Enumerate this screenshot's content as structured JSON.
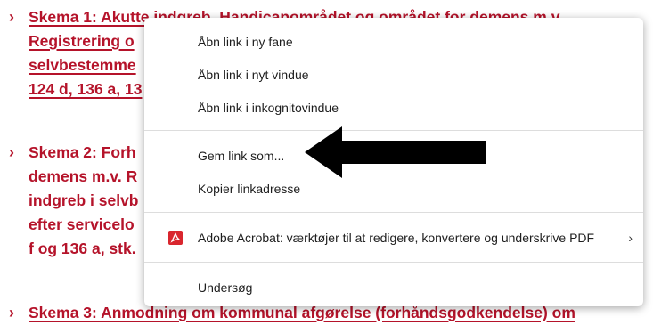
{
  "background_items": [
    {
      "lines": [
        "Skema 1: Akutte indgreb. Handicapområdet og området for demens m.v.",
        "Registrering o",
        "selvbestemme",
        "124 d, 136 a, 13"
      ],
      "link": true
    },
    {
      "lines": [
        "Skema 2: Forh",
        "demens m.v. R",
        "indgreb i selvb",
        "efter servicelo",
        "f og 136 a, stk."
      ],
      "link": false
    },
    {
      "lines": [
        "Skema 3: Anmodning om kommunal afgørelse (forhåndsgodkendelse) om"
      ],
      "link": true
    }
  ],
  "context_menu": {
    "open_new_tab": "Åbn link i ny fane",
    "open_new_window": "Åbn link i nyt vindue",
    "open_incognito": "Åbn link i inkognitovindue",
    "save_link_as": "Gem link som...",
    "copy_link_address": "Kopier linkadresse",
    "adobe_acrobat": "Adobe Acrobat: værktøjer til at redigere, konvertere og underskrive PDF",
    "adobe_icon": "adobe-pdf-icon",
    "submenu_arrow": "›",
    "inspect": "Undersøg"
  },
  "chevron": "›",
  "colors": {
    "link_red": "#b5132a",
    "adobe_red": "#d9262e",
    "annotation_arrow": "#000000"
  }
}
